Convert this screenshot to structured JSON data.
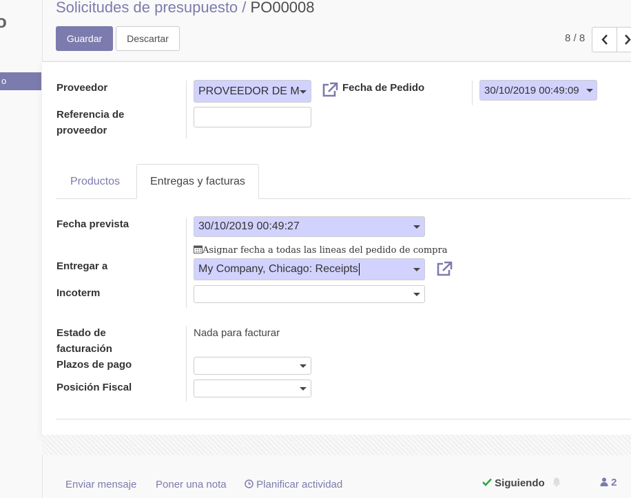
{
  "app": {
    "logo_fragment": "o",
    "active_menu": "o"
  },
  "breadcrumb": {
    "parent": "Solicitudes de presupuesto",
    "separator": "/",
    "current": "PO00008"
  },
  "buttons": {
    "save": "Guardar",
    "discard": "Descartar"
  },
  "pager": {
    "value": "8 / 8"
  },
  "form": {
    "vendor": {
      "label": "Proveedor",
      "value": "PROVEEDOR DE M"
    },
    "vendor_ref": {
      "label": "Referencia de proveedor",
      "value": ""
    },
    "order_date": {
      "label": "Fecha de Pedido",
      "value": "30/10/2019 00:49:09"
    }
  },
  "tabs": [
    {
      "label": "Productos",
      "active": false
    },
    {
      "label": "Entregas y facturas",
      "active": true
    }
  ],
  "deliveries": {
    "planned_date": {
      "label": "Fecha prevista",
      "value": "30/10/2019 00:49:27"
    },
    "assign_hint": "Asignar fecha a todas las lineas del pedido de compra",
    "deliver_to": {
      "label": "Entregar a",
      "value": "My Company, Chicago: Receipts"
    },
    "incoterm": {
      "label": "Incoterm",
      "value": ""
    },
    "invoice_status": {
      "label": "Estado de facturación",
      "value": "Nada para facturar"
    },
    "payment_terms": {
      "label": "Plazos de pago",
      "value": ""
    },
    "fiscal_position": {
      "label": "Posición Fiscal",
      "value": ""
    }
  },
  "chatter": {
    "send_message": "Enviar mensaje",
    "log_note": "Poner una nota",
    "schedule_activity": "Planificar actividad",
    "following": "Siguiendo",
    "followers_count": "2"
  },
  "colors": {
    "brand": "#7c7bad",
    "required_bg": "#d2d2ff",
    "following_check": "#28a745"
  }
}
